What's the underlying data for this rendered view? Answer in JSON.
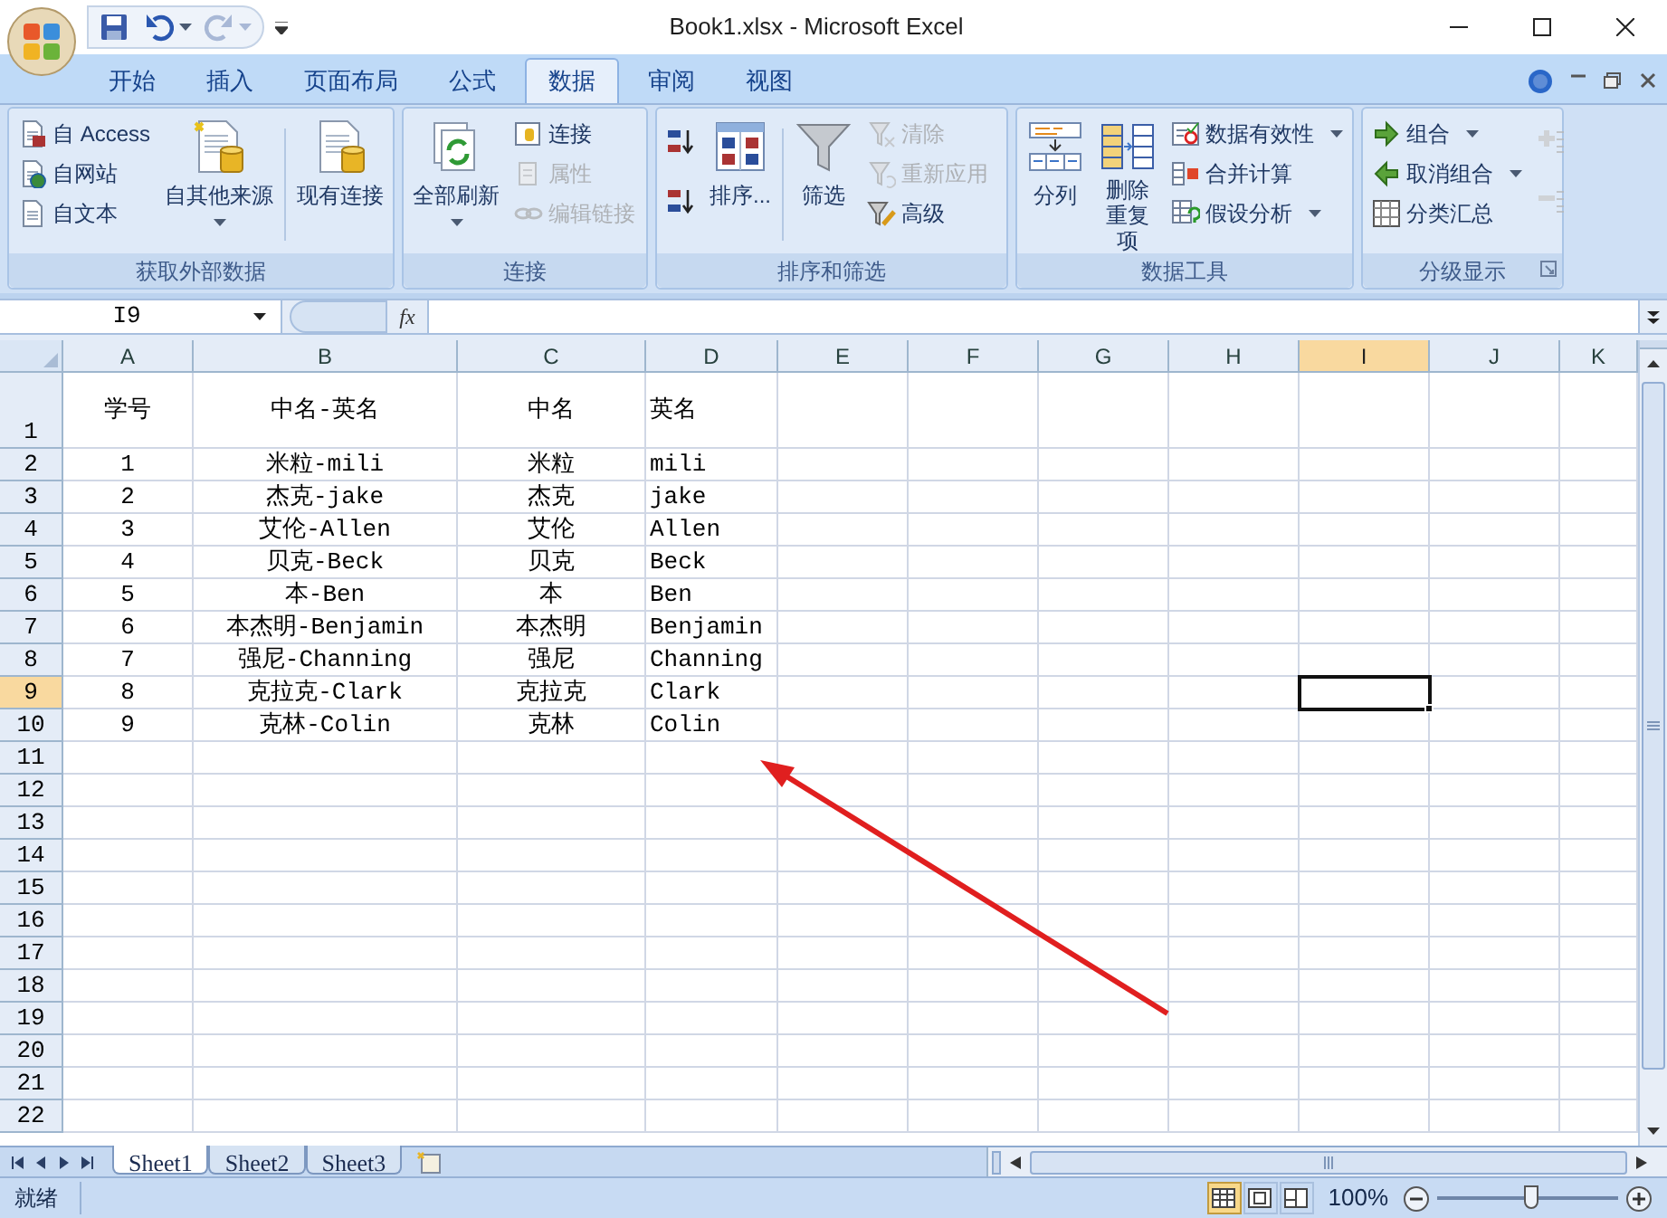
{
  "window": {
    "title": "Book1.xlsx - Microsoft Excel"
  },
  "tabs": [
    {
      "label": "开始",
      "selected": false
    },
    {
      "label": "插入",
      "selected": false
    },
    {
      "label": "页面布局",
      "selected": false
    },
    {
      "label": "公式",
      "selected": false
    },
    {
      "label": "数据",
      "selected": true
    },
    {
      "label": "审阅",
      "selected": false
    },
    {
      "label": "视图",
      "selected": false
    }
  ],
  "ribbon": [
    {
      "title": "获取外部数据",
      "launcher": false,
      "items": [
        {
          "kind": "stack",
          "items": [
            {
              "label": "自 Access",
              "disabled": false,
              "dropdown": false
            },
            {
              "label": "自网站",
              "disabled": false,
              "dropdown": false
            },
            {
              "label": "自文本",
              "disabled": false,
              "dropdown": false
            }
          ]
        },
        {
          "kind": "large",
          "label": "自其他来源",
          "dropdown": true
        },
        {
          "kind": "separator"
        },
        {
          "kind": "large",
          "label": "现有连接",
          "dropdown": false
        }
      ]
    },
    {
      "title": "连接",
      "launcher": false,
      "items": [
        {
          "kind": "large",
          "label": "全部刷新",
          "dropdown": true
        },
        {
          "kind": "stack",
          "items": [
            {
              "label": "连接",
              "disabled": false,
              "dropdown": false
            },
            {
              "label": "属性",
              "disabled": true,
              "dropdown": false
            },
            {
              "label": "编辑链接",
              "disabled": true,
              "dropdown": false
            }
          ]
        }
      ]
    },
    {
      "title": "排序和筛选",
      "launcher": false,
      "items": [
        {
          "kind": "stack",
          "items": [
            {
              "disabled": false,
              "dropdown": false
            },
            {
              "disabled": false,
              "dropdown": false
            }
          ]
        },
        {
          "kind": "large",
          "label": "排序...",
          "dropdown": false
        },
        {
          "kind": "separator"
        },
        {
          "kind": "large",
          "label": "筛选",
          "dropdown": false
        },
        {
          "kind": "stack",
          "items": [
            {
              "label": "清除",
              "disabled": true,
              "dropdown": false
            },
            {
              "label": "重新应用",
              "disabled": true,
              "dropdown": false
            },
            {
              "label": "高级",
              "disabled": false,
              "dropdown": false
            }
          ]
        }
      ]
    },
    {
      "title": "数据工具",
      "launcher": false,
      "items": [
        {
          "kind": "large",
          "label": "分列",
          "dropdown": false
        },
        {
          "kind": "large",
          "lines": [
            "删除",
            "重复项"
          ],
          "dropdown": false
        },
        {
          "kind": "stack",
          "items": [
            {
              "label": "数据有效性",
              "disabled": false,
              "dropdown": true
            },
            {
              "label": "合并计算",
              "disabled": false,
              "dropdown": false
            },
            {
              "label": "假设分析",
              "disabled": false,
              "dropdown": true
            }
          ]
        }
      ]
    },
    {
      "title": "分级显示",
      "launcher": true,
      "items": [
        {
          "kind": "stack",
          "items": [
            {
              "label": "组合",
              "disabled": false,
              "dropdown": true
            },
            {
              "label": "取消组合",
              "disabled": false,
              "dropdown": true
            },
            {
              "label": "分类汇总",
              "disabled": false,
              "dropdown": false
            }
          ]
        },
        {
          "kind": "stack",
          "items": [
            {
              "disabled": true,
              "dropdown": false
            },
            {
              "disabled": true,
              "dropdown": false
            }
          ]
        }
      ]
    }
  ],
  "formula_bar": {
    "name_box": "I9",
    "function_label": "fx"
  },
  "sheet": {
    "columns": [
      {
        "label": "A",
        "selected": false
      },
      {
        "label": "B",
        "selected": false
      },
      {
        "label": "C",
        "selected": false
      },
      {
        "label": "D",
        "selected": false
      },
      {
        "label": "E",
        "selected": false
      },
      {
        "label": "F",
        "selected": false
      },
      {
        "label": "G",
        "selected": false
      },
      {
        "label": "H",
        "selected": false
      },
      {
        "label": "I",
        "selected": true
      },
      {
        "label": "J",
        "selected": false
      },
      {
        "label": "K",
        "selected": false
      }
    ],
    "rows": [
      {
        "header": "1",
        "selected": false,
        "cells": [
          "学号",
          "中名-英名",
          "中名",
          "英名"
        ]
      },
      {
        "header": "2",
        "selected": false,
        "cells": [
          "1",
          "米粒-mili",
          "米粒",
          "mili"
        ]
      },
      {
        "header": "3",
        "selected": false,
        "cells": [
          "2",
          "杰克-jake",
          "杰克",
          "jake"
        ]
      },
      {
        "header": "4",
        "selected": false,
        "cells": [
          "3",
          "艾伦-Allen",
          "艾伦",
          "Allen"
        ]
      },
      {
        "header": "5",
        "selected": false,
        "cells": [
          "4",
          "贝克-Beck",
          "贝克",
          "Beck"
        ]
      },
      {
        "header": "6",
        "selected": false,
        "cells": [
          "5",
          "本-Ben",
          "本",
          "Ben"
        ]
      },
      {
        "header": "7",
        "selected": false,
        "cells": [
          "6",
          "本杰明-Benjamin",
          "本杰明",
          "Benjamin"
        ]
      },
      {
        "header": "8",
        "selected": false,
        "cells": [
          "7",
          "强尼-Channing",
          "强尼",
          "Channing"
        ]
      },
      {
        "header": "9",
        "selected": true,
        "cells": [
          "8",
          "克拉克-Clark",
          "克拉克",
          "Clark"
        ]
      },
      {
        "header": "10",
        "selected": false,
        "cells": [
          "9",
          "克林-Colin",
          "克林",
          "Colin"
        ]
      },
      {
        "header": "11",
        "selected": false
      },
      {
        "header": "12",
        "selected": false
      },
      {
        "header": "13",
        "selected": false
      },
      {
        "header": "14",
        "selected": false
      },
      {
        "header": "15",
        "selected": false
      },
      {
        "header": "16",
        "selected": false
      },
      {
        "header": "17",
        "selected": false
      },
      {
        "header": "18",
        "selected": false
      },
      {
        "header": "19",
        "selected": false
      },
      {
        "header": "20",
        "selected": false
      },
      {
        "header": "21",
        "selected": false
      },
      {
        "header": "22",
        "selected": false
      }
    ]
  },
  "sheet_tabs": [
    {
      "label": "Sheet1",
      "selected": true
    },
    {
      "label": "Sheet2",
      "selected": false
    },
    {
      "label": "Sheet3",
      "selected": false
    }
  ],
  "status_bar": {
    "text": "就绪",
    "views": [
      {
        "selected": true
      },
      {
        "selected": false
      },
      {
        "selected": false
      }
    ],
    "zoom": "100%",
    "zoom_slider": {
      "level": 0.52
    }
  }
}
